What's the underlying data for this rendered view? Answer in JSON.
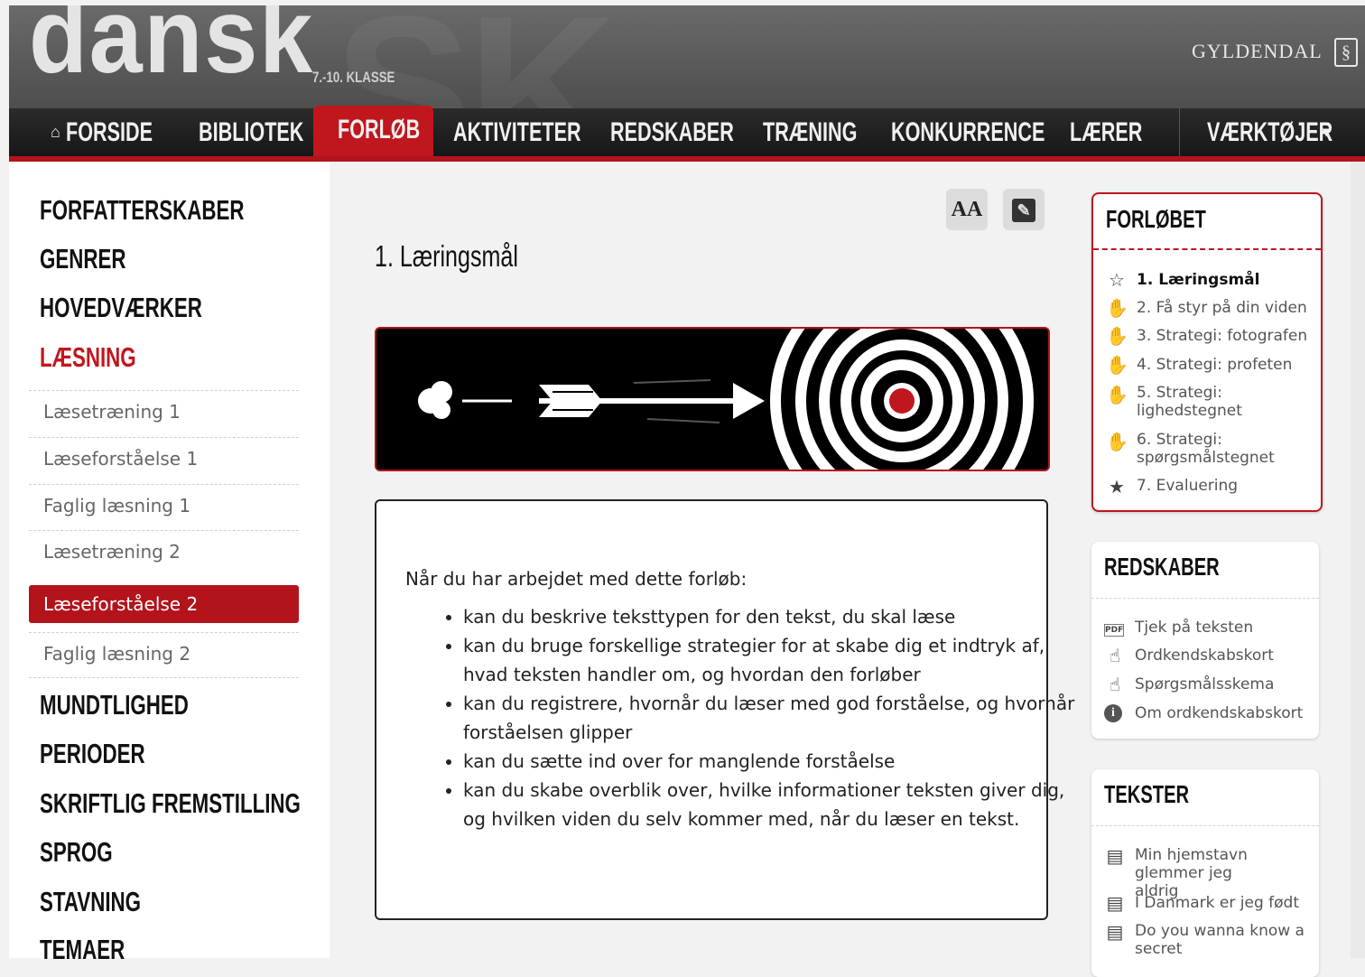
{
  "header": {
    "logo": "dansk",
    "subtitle": "7.-10. KLASSE",
    "publisher": "GYLDENDAL",
    "publisher_icon": "gyldendal-logo-icon"
  },
  "nav": {
    "items": [
      {
        "label": "FORSIDE",
        "icon": "house-icon"
      },
      {
        "label": "BIBLIOTEK"
      },
      {
        "label": "FORLØB",
        "active": true
      },
      {
        "label": "AKTIVITETER"
      },
      {
        "label": "REDSKABER"
      },
      {
        "label": "TRÆNING"
      },
      {
        "label": "KONKURRENCE"
      },
      {
        "label": "LÆRER"
      },
      {
        "label": "VÆRKTØJER",
        "dropdown": true
      }
    ],
    "home_glyph": "⌂",
    "dropdown_glyph": "▾"
  },
  "sidebar": {
    "headings_top": [
      "FORFATTERSKABER",
      "GENRER",
      "HOVEDVÆRKER",
      "LÆSNING"
    ],
    "subitems": [
      "Læsetræning 1",
      "Læseforståelse 1",
      "Faglig læsning 1",
      "Læsetræning 2",
      "Læseforståelse 2",
      "Faglig læsning 2"
    ],
    "active_subitem": "Læseforståelse 2",
    "headings_bottom": [
      "MUNDTLIGHED",
      "PERIODER",
      "SKRIFTLIG FREMSTILLING",
      "SPROG",
      "STAVNING",
      "TEMAER"
    ]
  },
  "main": {
    "font_button": "AA",
    "edit_glyph": "✎",
    "title": "1. Læringsmål",
    "intro": "Når du har arbejdet med dette forløb:",
    "goals": [
      "kan du beskrive teksttypen for den tekst, du skal læse",
      "kan du bruge forskellige strategier for at skabe dig et indtryk af, hvad teksten handler om, og hvordan den forløber",
      "kan du registrere, hvornår du læser med god forståelse, og hvornår forståelsen glipper",
      "kan du sætte ind over for manglende forståelse",
      "kan du skabe overblik over, hvilke informationer teksten giver dig, og hvilken viden du selv kommer med, når du læser en tekst."
    ]
  },
  "forloebet": {
    "title": "FORLØBET",
    "items": [
      {
        "label": "1. Læringsmål",
        "icon": "☆",
        "current": true
      },
      {
        "label": "2. Få styr på din viden",
        "icon": "✋"
      },
      {
        "label": "3. Strategi: fotografen",
        "icon": "✋"
      },
      {
        "label": "4. Strategi: profeten",
        "icon": "✋"
      },
      {
        "label": "5. Strategi: lighedstegnet",
        "icon": "✋"
      },
      {
        "label": "6. Strategi: spørgsmålstegnet",
        "icon": "✋"
      },
      {
        "label": "7. Evaluering",
        "icon": "★"
      }
    ]
  },
  "redskaber": {
    "title": "REDSKABER",
    "items": [
      {
        "label": "Tjek på teksten",
        "icon": "PDF"
      },
      {
        "label": "Ordkendskabskort",
        "icon": "☝"
      },
      {
        "label": "Spørgsmålsskema",
        "icon": "☝"
      },
      {
        "label": "Om ordkendskabskort",
        "icon": "i"
      }
    ]
  },
  "tekster": {
    "title": "TEKSTER",
    "items": [
      {
        "label": "Min hjemstavn glemmer jeg aldrig",
        "icon": "▤"
      },
      {
        "label": "I Danmark er jeg født",
        "icon": "▤"
      },
      {
        "label": "Do you wanna know a secret",
        "icon": "▤"
      }
    ]
  },
  "colors": {
    "accent": "#c0161e",
    "nav_bg": "#1f1f1f",
    "header_bg": "#5e5e5e"
  }
}
